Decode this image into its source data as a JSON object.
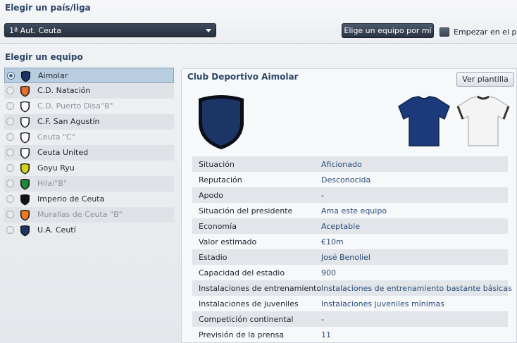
{
  "country_section": {
    "title": "Elegir un país/liga",
    "league_selected": "1ª Aut. Ceuta",
    "choose_team_button": "Elige un equipo por mí",
    "start_checkbox_label": "Empezar en el paro"
  },
  "team_section": {
    "title": "Elegir un equipo",
    "teams": [
      {
        "name": "Aimolar",
        "selected": true,
        "disabled": false,
        "crest_color": "#1c3566"
      },
      {
        "name": "C.D. Natación",
        "selected": false,
        "disabled": false,
        "crest_color": "#e8702a"
      },
      {
        "name": "C.D. Puerto Disa\"B\"",
        "selected": false,
        "disabled": true,
        "crest_color": "#ffffff"
      },
      {
        "name": "C.F. San Agustín",
        "selected": false,
        "disabled": false,
        "crest_color": "#ffffff"
      },
      {
        "name": "Ceuta \"C\"",
        "selected": false,
        "disabled": true,
        "crest_color": "#ffffff"
      },
      {
        "name": "Ceuta United",
        "selected": false,
        "disabled": false,
        "crest_color": "#ffffff"
      },
      {
        "name": "Goyu Ryu",
        "selected": false,
        "disabled": false,
        "crest_color": "#d6d21a"
      },
      {
        "name": "Hilal\"B\"",
        "selected": false,
        "disabled": true,
        "crest_color": "#1f8a3a"
      },
      {
        "name": "Imperio de Ceuta",
        "selected": false,
        "disabled": false,
        "crest_color": "#111111"
      },
      {
        "name": "Murallas de Ceuta \"B\"",
        "selected": false,
        "disabled": true,
        "crest_color": "#f07a22"
      },
      {
        "name": "U.A. Ceutí",
        "selected": false,
        "disabled": false,
        "crest_color": "#1c3566"
      }
    ]
  },
  "club_panel": {
    "title": "Club Deportivo Aimolar",
    "view_squad_button": "Ver plantilla",
    "crest_color": "#1c3566",
    "home_kit_color": "#1c3a7a",
    "away_kit_color": "#f4f4f4",
    "info": [
      {
        "label": "Situación",
        "value": "Aficionado",
        "link": true
      },
      {
        "label": "Reputación",
        "value": "Desconocida",
        "link": true
      },
      {
        "label": "Apodo",
        "value": "-",
        "link": false
      },
      {
        "label": "Situación del presidente",
        "value": "Ama este equipo",
        "link": true
      },
      {
        "label": "Economía",
        "value": "Aceptable",
        "link": true
      },
      {
        "label": "Valor estimado",
        "value": "€10m",
        "link": true
      },
      {
        "label": "Estadio",
        "value": "José Benoliel",
        "link": true
      },
      {
        "label": "Capacidad del estadio",
        "value": "900",
        "link": true
      },
      {
        "label": "Instalaciones de entrenamiento",
        "value": "Instalaciones de entrenamiento bastante básicas",
        "link": true
      },
      {
        "label": "Instalaciones de juveniles",
        "value": "Instalaciones juveniles mínimas",
        "link": true
      },
      {
        "label": "Competición continental",
        "value": "-",
        "link": false
      },
      {
        "label": "Previsión de la prensa",
        "value": "11",
        "link": true
      }
    ]
  }
}
